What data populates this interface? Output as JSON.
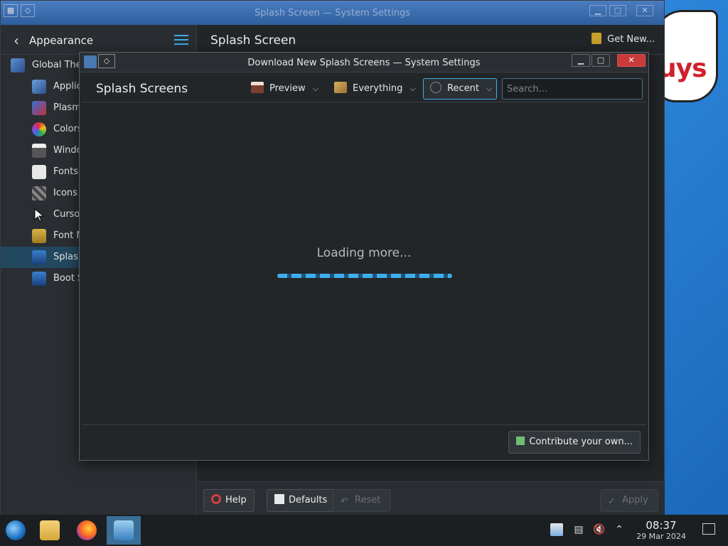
{
  "main_window": {
    "title": "Splash Screen — System Settings",
    "sidebar": {
      "title": "Appearance",
      "items": [
        {
          "label": "Global Theme",
          "icon": "global-theme-icon"
        },
        {
          "label": "Applica",
          "icon": "application-style-icon"
        },
        {
          "label": "Plasma",
          "icon": "plasma-style-icon"
        },
        {
          "label": "Colors",
          "icon": "colors-icon"
        },
        {
          "label": "Windo",
          "icon": "window-decorations-icon"
        },
        {
          "label": "Fonts",
          "icon": "fonts-icon"
        },
        {
          "label": "Icons",
          "icon": "icons-icon"
        },
        {
          "label": "Cursor",
          "icon": "cursors-icon"
        },
        {
          "label": "Font M",
          "icon": "font-management-icon"
        },
        {
          "label": "Splash",
          "icon": "splash-screen-icon"
        },
        {
          "label": "Boot S",
          "icon": "boot-splash-icon"
        }
      ],
      "selected_index": 9
    },
    "content_title": "Splash Screen",
    "get_new_label": "Get New...",
    "bottom": {
      "help": "Help",
      "defaults": "Defaults",
      "reset": "Reset",
      "apply": "Apply"
    }
  },
  "dialog": {
    "title": "Download New Splash Screens — System Settings",
    "heading": "Splash Screens",
    "view_mode": "Preview",
    "filter": "Everything",
    "sort": "Recent",
    "search_placeholder": "Search...",
    "loading_text": "Loading more...",
    "progress": 1.0,
    "contribute_label": "Contribute your own..."
  },
  "desktop": {
    "art_text": "uys"
  },
  "taskbar": {
    "apps": [
      "start-menu-icon",
      "file-manager-icon",
      "firefox-icon",
      "system-settings-icon"
    ],
    "time": "08:37",
    "date": "29 Mar 2024"
  },
  "colors": {
    "accent": "#3daee9",
    "window_bg": "#232629",
    "selection": "#22485f",
    "close_red": "#c93a3a"
  }
}
